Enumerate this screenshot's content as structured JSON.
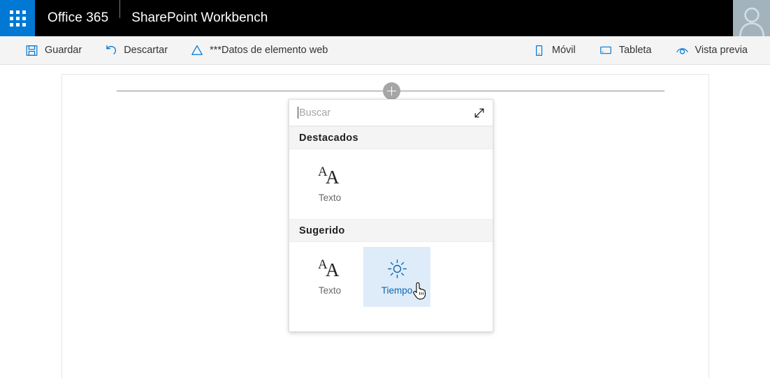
{
  "suite_bar": {
    "waffle_icon": "app-launcher-waffle-icon",
    "brand": "Office 365",
    "app_name": "SharePoint Workbench",
    "avatar_icon": "user-avatar-icon",
    "background_color": "#000000",
    "waffle_color": "#0078d4"
  },
  "command_bar": {
    "background_color": "#f4f4f4",
    "icon_color": "#0078d4",
    "left_items": [
      {
        "label": "Guardar",
        "icon": "save-icon"
      },
      {
        "label": "Descartar",
        "icon": "undo-icon"
      },
      {
        "label": "***Datos de elemento web",
        "icon": "triangle-icon"
      }
    ],
    "right_items": [
      {
        "label": "Móvil",
        "icon": "mobile-icon"
      },
      {
        "label": "Tableta",
        "icon": "tablet-icon"
      },
      {
        "label": "Vista previa",
        "icon": "preview-eye-icon"
      }
    ]
  },
  "canvas": {
    "add_button_icon": "add-plus-icon",
    "add_button_color": "#a6a6a6"
  },
  "picker": {
    "search": {
      "placeholder": "Buscar",
      "value": ""
    },
    "expand_icon": "expand-diagonal-icon",
    "sections": [
      {
        "title": "Destacados",
        "tiles": [
          {
            "label": "Texto",
            "icon": "text-aa-icon",
            "selected": false
          }
        ]
      },
      {
        "title": "Sugerido",
        "tiles": [
          {
            "label": "Texto",
            "icon": "text-aa-icon",
            "selected": false
          },
          {
            "label": "Tiempo",
            "icon": "weather-sun-icon",
            "selected": true
          }
        ]
      }
    ],
    "selected_tile_color": "#deecf9",
    "selected_text_color": "#0d66b0"
  },
  "cursor": {
    "type": "pointer-hand-cursor"
  }
}
